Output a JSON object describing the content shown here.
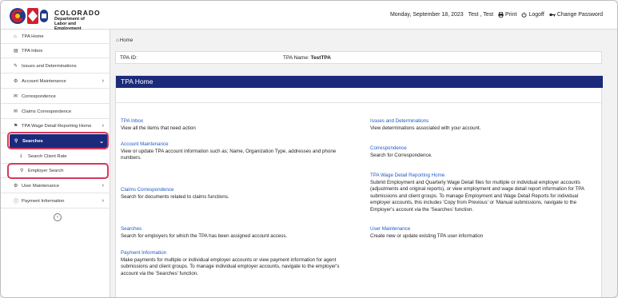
{
  "header": {
    "logo_title": "COLORADO",
    "logo_sub_1": "Department of",
    "logo_sub_2": "Labor and Employment",
    "datetime": "Monday, September 18, 2023",
    "user": "Test , Test",
    "print": "Print",
    "logoff": "Logoff",
    "change_password": "Change Password"
  },
  "sidebar": {
    "items": [
      {
        "label": "TPA Home",
        "icon": "home-icon"
      },
      {
        "label": "TPA Inbox",
        "icon": "inbox-icon"
      },
      {
        "label": "Issues and Determinations",
        "icon": "wrench-icon"
      },
      {
        "label": "Account Maintenance",
        "icon": "gears-icon"
      },
      {
        "label": "Correspondence",
        "icon": "envelope-icon"
      },
      {
        "label": "Claims Correspondence",
        "icon": "envelope-icon"
      },
      {
        "label": "TPA Wage Detail Reporting Home",
        "icon": "flag-icon"
      },
      {
        "label": "Searches",
        "icon": "search-icon"
      },
      {
        "label": "Search Client Rate",
        "icon": "download-icon"
      },
      {
        "label": "Employer Search",
        "icon": "search-icon"
      },
      {
        "label": "User Maintenance",
        "icon": "gears-icon"
      },
      {
        "label": "Payment Information",
        "icon": "info-icon"
      }
    ]
  },
  "breadcrumb": {
    "home": "Home"
  },
  "tpa_bar": {
    "id_label": "TPA ID:",
    "name_label": "TPA Name:",
    "name_value": "TestTPA"
  },
  "panel": {
    "title": "TPA Home",
    "cards": [
      {
        "title": "TPA Inbox",
        "desc": "View all the items that need action"
      },
      {
        "title": "Account Maintenance",
        "desc": "View or update TPA account information such as; Name, Organization Type, addresses and phone numbers."
      },
      {
        "title": "Claims Correspondence",
        "desc": "Search for documents related to claims functions."
      },
      {
        "title": "Searches",
        "desc": "Search for employers for which the TPA has been assigned account access."
      },
      {
        "title": "Payment Information",
        "desc": "Make payments for multiple or individual employer accounts or view payment information for agent submissions and client groups. To manage individual employer accounts, navigate to the employer's account via the 'Searches' function."
      },
      {
        "title": "Issues and Determinations",
        "desc": "View determinations associated with your account."
      },
      {
        "title": "Correspondence",
        "desc": "Search for Correspondence."
      },
      {
        "title": "TPA Wage Detail Reporting Home",
        "desc": "Submit Employment and Quarterly Wage Detail files for multiple or individual employer accounts (adjustments and original reports), or view employment and wage detail report information for TPA submissions and client groups. To manage Employment and Wage Detail Reports for individual employer accounts, this includes 'Copy from Previous' or 'Manual submissions, navigate to the Employer's account via the 'Searches' function."
      },
      {
        "title": "User Maintenance",
        "desc": "Create new or update existing TPA user information"
      }
    ]
  },
  "colors": {
    "nav_blue": "#1b2a7a",
    "link_blue": "#2259c7",
    "highlight_ring": "#d6385a"
  }
}
